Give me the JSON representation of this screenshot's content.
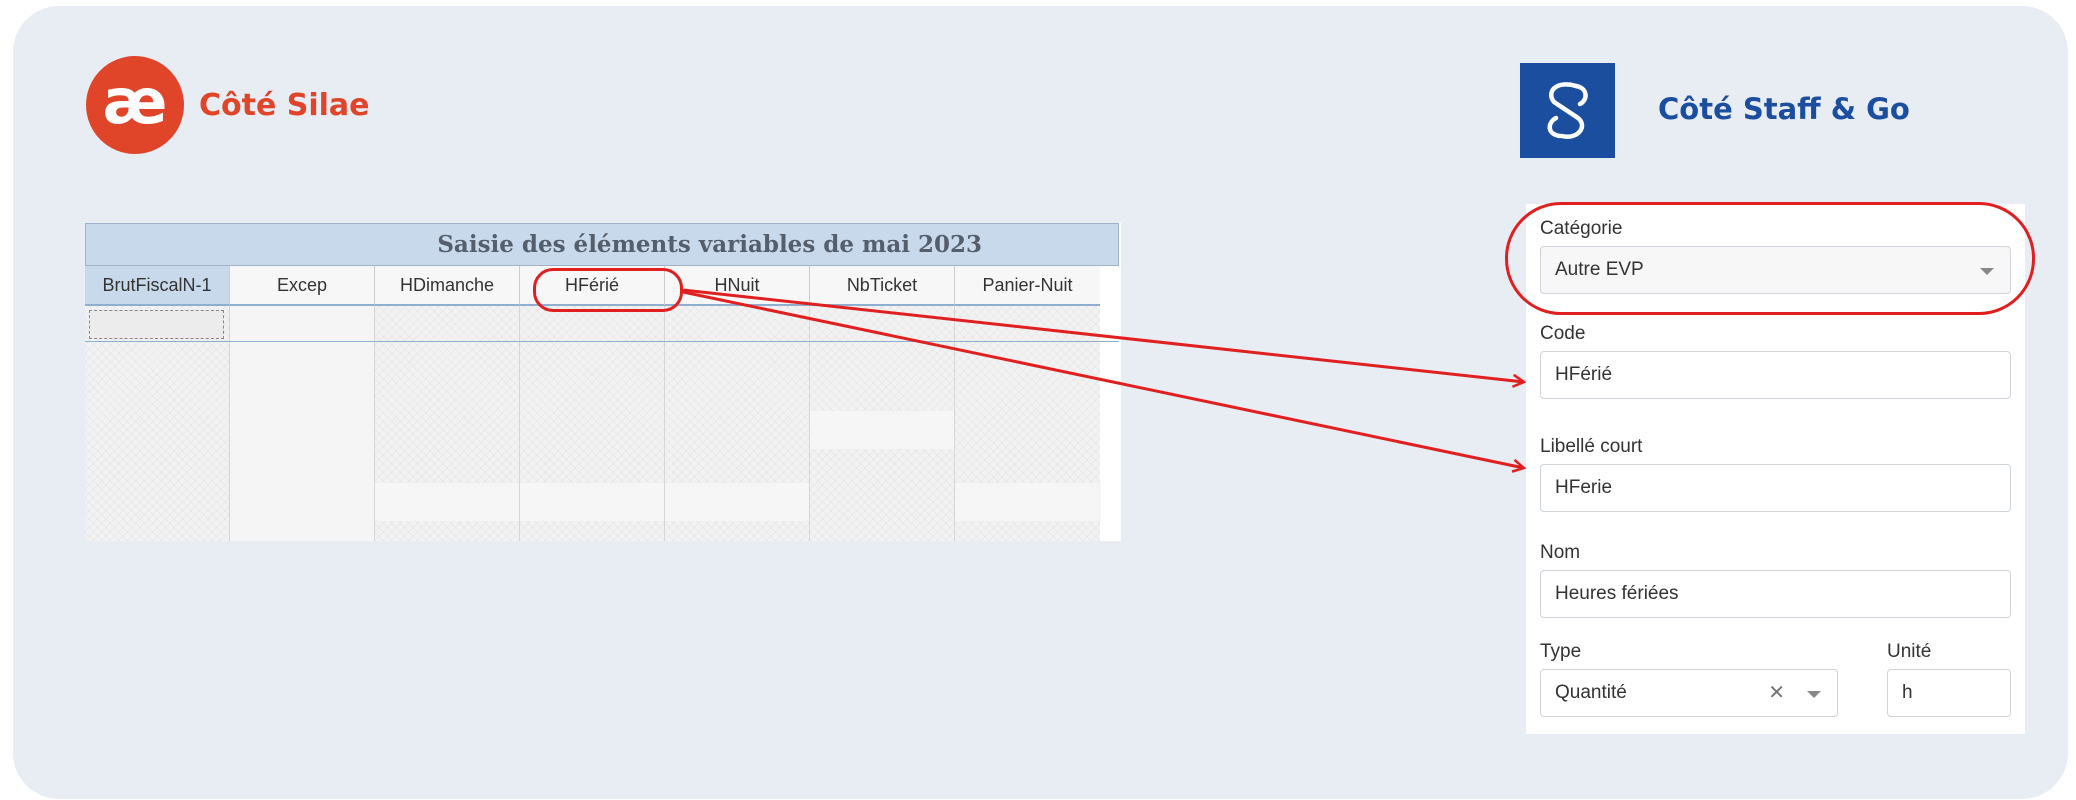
{
  "colors": {
    "silae": "#e0452a",
    "staffgo": "#1b4e9e",
    "annotation": "#e02020",
    "panel": "#e8ecf3"
  },
  "silae": {
    "logo_glyph": "æ",
    "title": "Côté Silae",
    "grid": {
      "title": "Saisie des éléments variables de mai 2023",
      "columns": [
        "BrutFiscalN-1",
        "Excep",
        "HDimanche",
        "HFérié",
        "HNuit",
        "NbTicket",
        "Panier-Nuit"
      ]
    }
  },
  "staffgo": {
    "logo_icon": "link-s-icon",
    "title": "Côté Staff & Go",
    "form": {
      "category_label": "Catégorie",
      "category_value": "Autre EVP",
      "code_label": "Code",
      "code_value": "HFérié",
      "short_label_label": "Libellé court",
      "short_label_value": "HFerie",
      "name_label": "Nom",
      "name_value": "Heures fériées",
      "type_label": "Type",
      "type_value": "Quantité",
      "unit_label": "Unité",
      "unit_value": "h"
    }
  }
}
